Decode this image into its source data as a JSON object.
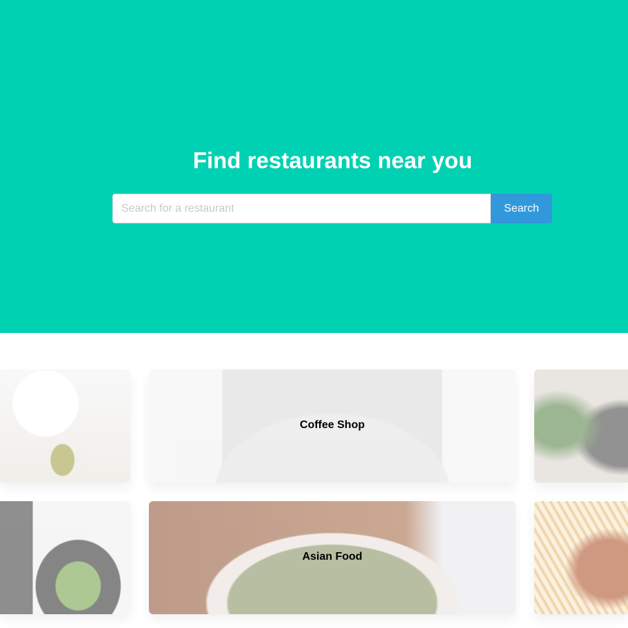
{
  "colors": {
    "hero": "#00D1B2",
    "button": "#3298DC"
  },
  "hero": {
    "title": "Find restaurants near you"
  },
  "search": {
    "placeholder": "Search for a restaurant",
    "button_label": "Search"
  },
  "categories": [
    {
      "label": "Coffee Shop"
    },
    {
      "label": "Asian Food"
    }
  ]
}
